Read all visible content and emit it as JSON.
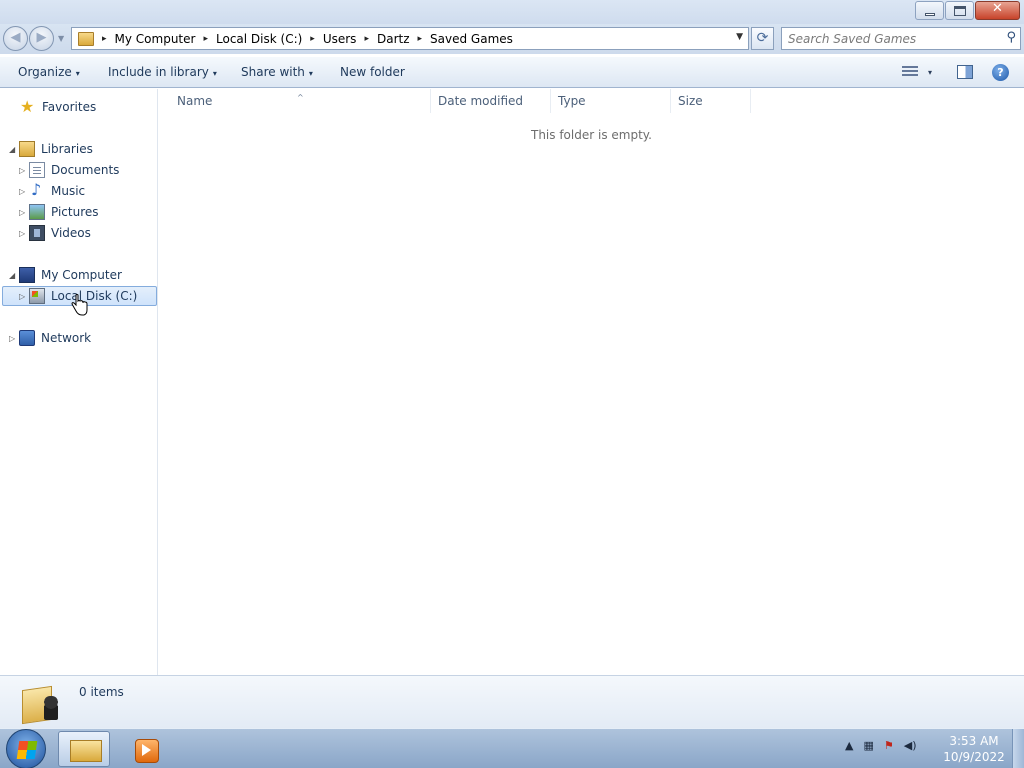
{
  "window": {
    "minimize_glyph": "—",
    "close_glyph": "✕"
  },
  "address": {
    "crumbs": [
      "My Computer",
      "Local Disk (C:)",
      "Users",
      "Dartz",
      "Saved Games"
    ],
    "separator": "▸",
    "refresh_glyph": "⟳"
  },
  "search": {
    "placeholder": "Search Saved Games",
    "icon": "search-icon"
  },
  "toolbar": {
    "organize": "Organize",
    "include_in_library": "Include in library",
    "share_with": "Share with",
    "new_folder": "New folder",
    "caret": "▾",
    "help_glyph": "?"
  },
  "nav": {
    "favorites": "Favorites",
    "libraries": "Libraries",
    "documents": "Documents",
    "music": "Music",
    "pictures": "Pictures",
    "videos": "Videos",
    "my_computer": "My Computer",
    "local_disk": "Local Disk (C:)",
    "network": "Network",
    "expanded_glyph": "◢",
    "collapsed_glyph": "▷"
  },
  "columns": {
    "name": "Name",
    "date_modified": "Date modified",
    "type": "Type",
    "size": "Size",
    "sort_glyph": "^"
  },
  "content": {
    "empty_message": "This folder is empty."
  },
  "details": {
    "item_count": "0 items"
  },
  "taskbar": {
    "time": "3:53 AM",
    "date": "10/9/2022",
    "tray_up": "▲",
    "volume_glyph": "🔊"
  },
  "colors": {
    "accent": "#1e395b",
    "selection_border": "#84acdd",
    "taskbar": "#8aa6c8"
  }
}
